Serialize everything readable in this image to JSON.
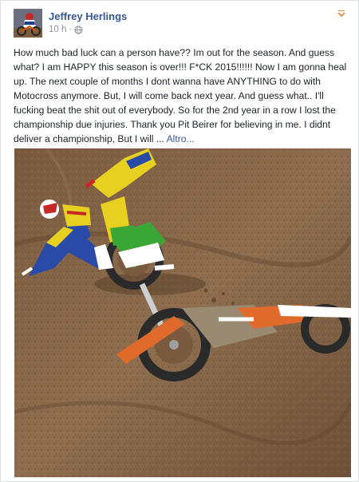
{
  "post": {
    "author": "Jeffrey Herlings",
    "time": "10 h",
    "separator": "·",
    "privacy_icon": "globe-icon",
    "menu_icon": "chevron-down-icon",
    "text": "How much bad luck can a person have?? Im out for the season. And guess what? I am HAPPY this season is over!!! F*CK 2015!!!!!! Now I am gonna heal up. The next couple of months I dont wanna have ANYTHING to do with Motocross anymore. But, I will come back next year. And guess what.. I'll fucking beat the shit out of everybody. So for the 2nd year in a row I lost the championship due injuries. Thank you Pit Beirer for believing in me. I didnt deliver a championship, But I will ...",
    "more_label": "Altro..."
  },
  "photo": {
    "accent_colors": {
      "dirt": "#8a6a4a",
      "green_bike": "#3aa635",
      "yellow_gear": "#e8d020",
      "orange_bike": "#e06a2a",
      "blue_gear": "#2a4aa8"
    }
  },
  "colors": {
    "link": "#365899",
    "text": "#1d2129",
    "meta": "#90949c"
  }
}
